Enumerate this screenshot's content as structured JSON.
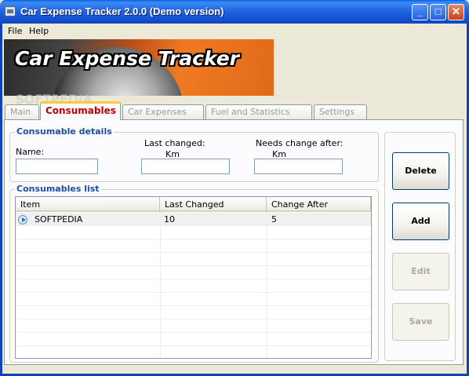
{
  "window": {
    "title": "Car Expense Tracker 2.0.0 (Demo version)",
    "controls": {
      "minimize": "_",
      "maximize": "□",
      "close": "✕"
    }
  },
  "menu": [
    {
      "label": "File"
    },
    {
      "label": "Help"
    }
  ],
  "banner": {
    "text": "Car Expense Tracker",
    "watermark": "SOFTPEDIA"
  },
  "tabs": [
    {
      "label": "Main",
      "active": false
    },
    {
      "label": "Consumables",
      "active": true
    },
    {
      "label": "Car Expenses",
      "active": false
    },
    {
      "label": "Fuel and Statistics",
      "active": false
    },
    {
      "label": "Settings",
      "active": false
    }
  ],
  "consumable_details": {
    "title": "Consumable details",
    "name_label": "Name:",
    "name_value": "",
    "last_changed_label": "Last changed:",
    "last_changed_unit": "Km",
    "last_changed_value": "",
    "needs_change_label": "Needs change after:",
    "needs_change_unit": "Km",
    "needs_change_value": ""
  },
  "consumables_list": {
    "title": "Consumables list",
    "columns": [
      "Item",
      "Last Changed",
      "Change After"
    ],
    "rows": [
      {
        "item": "SOFTPEDIA",
        "last_changed": "10",
        "change_after": "5",
        "selected": true
      }
    ]
  },
  "actions": {
    "delete": {
      "label": "Delete",
      "enabled": true
    },
    "add": {
      "label": "Add",
      "enabled": true
    },
    "edit": {
      "label": "Edit",
      "enabled": false
    },
    "save": {
      "label": "Save",
      "enabled": false
    }
  },
  "colors": {
    "titlebar": "#2265e0",
    "active_tab_text": "#c00000",
    "group_title": "#1a4ea0",
    "banner_orange": "#f07a22"
  }
}
